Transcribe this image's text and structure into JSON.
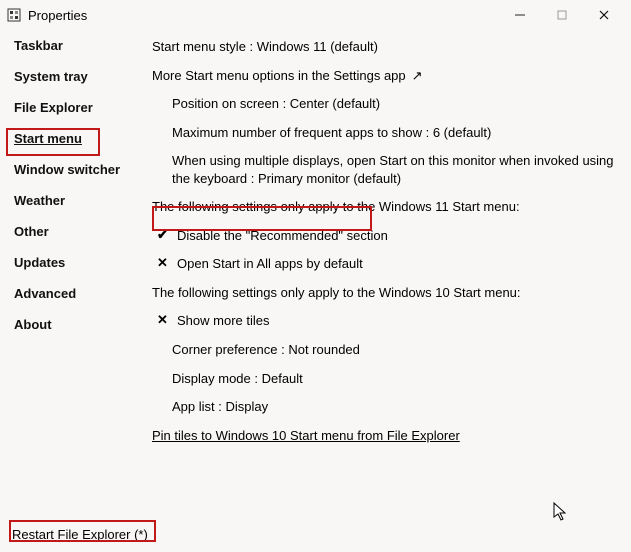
{
  "titlebar": {
    "title": "Properties"
  },
  "sidebar": {
    "items": [
      {
        "label": "Taskbar"
      },
      {
        "label": "System tray"
      },
      {
        "label": "File Explorer"
      },
      {
        "label": "Start menu"
      },
      {
        "label": "Window switcher"
      },
      {
        "label": "Weather"
      },
      {
        "label": "Other"
      },
      {
        "label": "Updates"
      },
      {
        "label": "Advanced"
      },
      {
        "label": "About"
      }
    ]
  },
  "main": {
    "style_line": "Start menu style : Windows 11 (default)",
    "more_options": "More Start menu options in the Settings app",
    "position": "Position on screen : Center (default)",
    "max_frequent": "Maximum number of frequent apps to show : 6 (default)",
    "multi_display": "When using multiple displays, open Start on this monitor when invoked using the keyboard : Primary monitor (default)",
    "w11_header": "The following settings only apply to the Windows 11 Start menu:",
    "disable_recommended": "Disable the \"Recommended\" section",
    "open_all_apps": "Open Start in All apps by default",
    "w10_header": "The following settings only apply to the Windows 10 Start menu:",
    "show_more_tiles": "Show more tiles",
    "corner_pref": "Corner preference : Not rounded",
    "display_mode": "Display mode : Default",
    "app_list": "App list : Display",
    "pin_tiles": "Pin tiles to Windows 10 Start menu from File Explorer"
  },
  "footer": {
    "restart": "Restart File Explorer (*)"
  }
}
